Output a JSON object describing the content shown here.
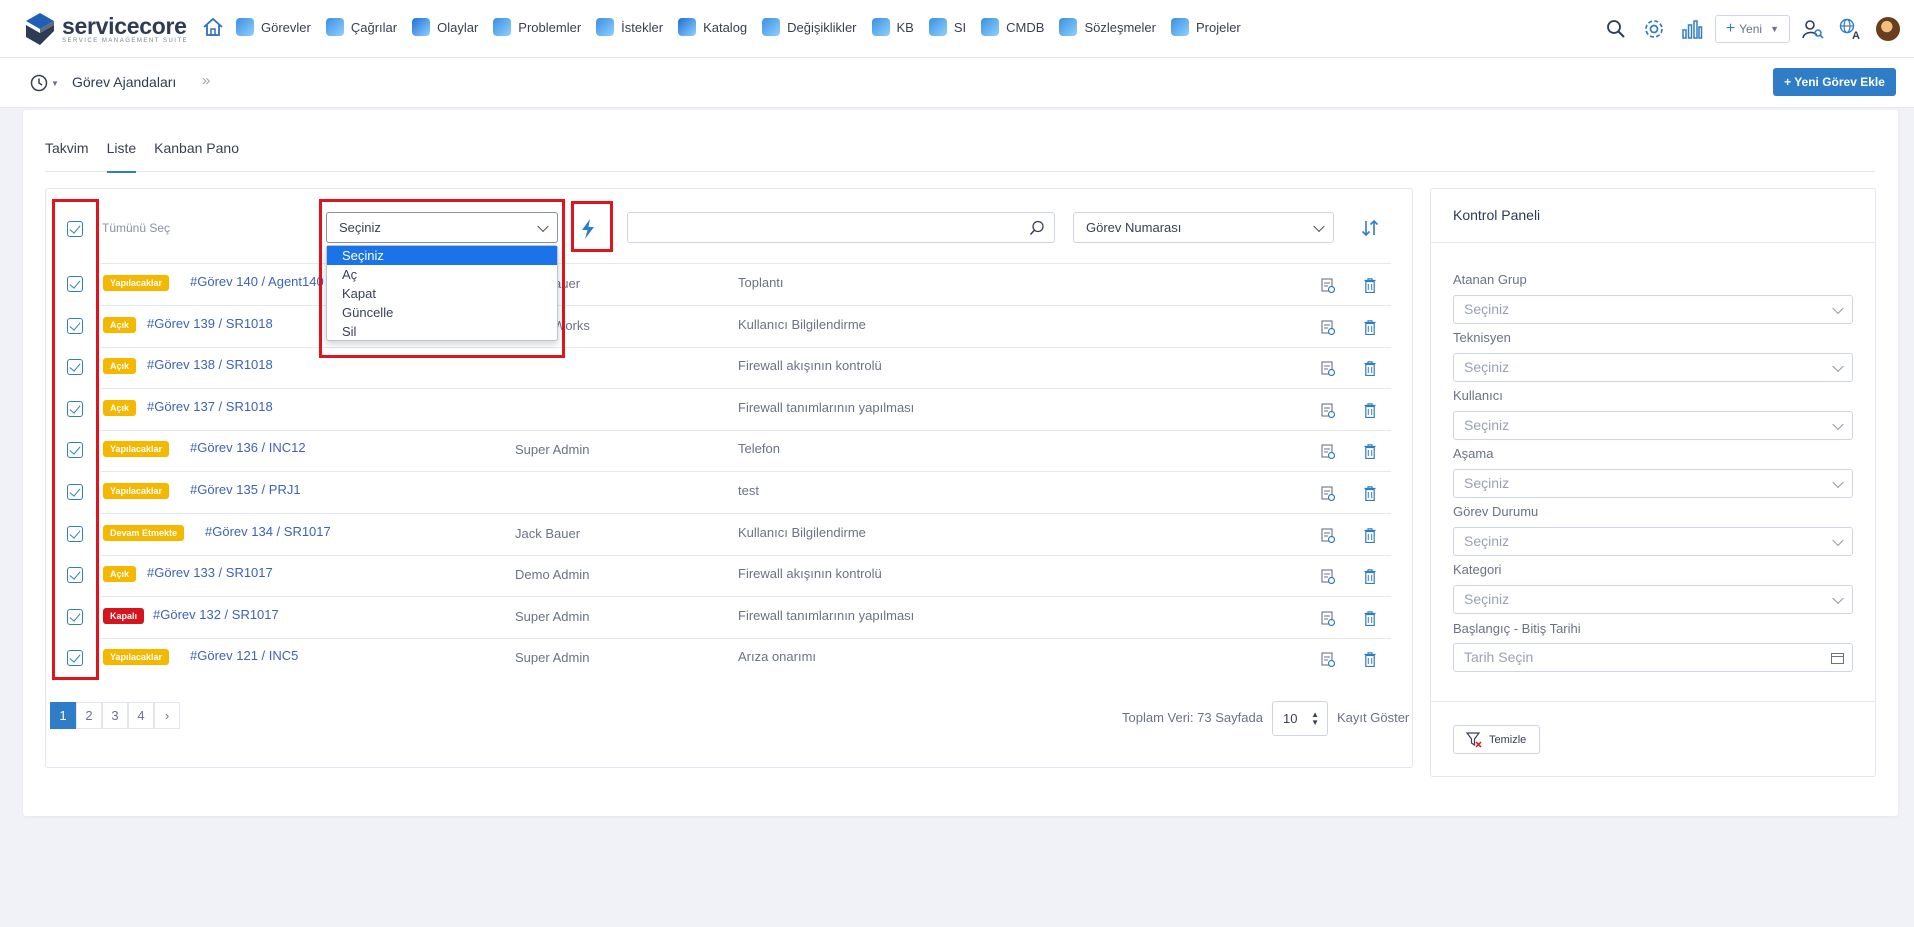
{
  "app": {
    "name": "servicecore",
    "tagline": "SERVICE MANAGEMENT SUITE"
  },
  "nav": [
    {
      "label": "Görevler",
      "icon": "tasks-icon",
      "color": "#3b8fe0"
    },
    {
      "label": "Çağrılar",
      "icon": "calls-icon",
      "color": "#3b8fe0"
    },
    {
      "label": "Olaylar",
      "icon": "incidents-icon",
      "color": "#1d6fd6"
    },
    {
      "label": "Problemler",
      "icon": "problems-icon",
      "color": "#3b8fe0"
    },
    {
      "label": "İstekler",
      "icon": "requests-icon",
      "color": "#3b8fe0"
    },
    {
      "label": "Katalog",
      "icon": "catalog-icon",
      "color": "#1d6fd6"
    },
    {
      "label": "Değişiklikler",
      "icon": "changes-icon",
      "color": "#3b8fe0"
    },
    {
      "label": "KB",
      "icon": "kb-icon",
      "color": "#3b8fe0"
    },
    {
      "label": "SI",
      "icon": "si-icon",
      "color": "#3b8fe0"
    },
    {
      "label": "CMDB",
      "icon": "cmdb-icon",
      "color": "#3b8fe0"
    },
    {
      "label": "Sözleşmeler",
      "icon": "contracts-icon",
      "color": "#3b8fe0"
    },
    {
      "label": "Projeler",
      "icon": "projects-icon",
      "color": "#3b8fe0"
    }
  ],
  "topright": {
    "new_label": "Yeni"
  },
  "breadcrumb": {
    "title": "Görev Ajandaları"
  },
  "add_task_button": "+ Yeni Görev Ekle",
  "tabs": [
    {
      "label": "Takvim",
      "active": false
    },
    {
      "label": "Liste",
      "active": true
    },
    {
      "label": "Kanban Pano",
      "active": false
    }
  ],
  "toolbar": {
    "select_all_label": "Tümünü Seç",
    "action_select_value": "Seçiniz",
    "action_options": [
      "Seçiniz",
      "Aç",
      "Kapat",
      "Güncelle",
      "Sil"
    ],
    "search_value": "",
    "sort_select_value": "Görev Numarası"
  },
  "rows": [
    {
      "status": "Yapılacaklar",
      "status_color": "#f5b800",
      "task": "#Görev 140 / Agent140",
      "user": "Jack Bauer",
      "title": "Toplantı"
    },
    {
      "status": "Açık",
      "status_color": "#f5b800",
      "task": "#Görev 139 / SR1018",
      "user": "Demo Works",
      "title": "Kullanıcı Bilgilendirme"
    },
    {
      "status": "Açık",
      "status_color": "#f5b800",
      "task": "#Görev 138 / SR1018",
      "user": "",
      "title": "Firewall akışının kontrolü"
    },
    {
      "status": "Açık",
      "status_color": "#f5b800",
      "task": "#Görev 137 / SR1018",
      "user": "",
      "title": "Firewall tanımlarının yapılması"
    },
    {
      "status": "Yapılacaklar",
      "status_color": "#f5b800",
      "task": "#Görev 136 / INC12",
      "user": "Super Admin",
      "title": "Telefon"
    },
    {
      "status": "Yapılacaklar",
      "status_color": "#f5b800",
      "task": "#Görev 135 / PRJ1",
      "user": "",
      "title": "test"
    },
    {
      "status": "Devam Etmekte",
      "status_color": "#f5b800",
      "task": "#Görev 134 / SR1017",
      "user": "Jack Bauer",
      "title": "Kullanıcı Bilgilendirme"
    },
    {
      "status": "Açık",
      "status_color": "#f5b800",
      "task": "#Görev 133 / SR1017",
      "user": "Demo Admin",
      "title": "Firewall akışının kontrolü"
    },
    {
      "status": "Kapalı",
      "status_color": "#d6141e",
      "task": "#Görev 132 / SR1017",
      "user": "Super Admin",
      "title": "Firewall tanımlarının yapılması"
    },
    {
      "status": "Yapılacaklar",
      "status_color": "#f5b800",
      "task": "#Görev 121 / INC5",
      "user": "Super Admin",
      "title": "Arıza onarımı"
    }
  ],
  "pagination": {
    "pages": [
      "1",
      "2",
      "3",
      "4",
      "›"
    ],
    "current": "1",
    "total_label": "Toplam Veri: 73",
    "per_page_prefix": "Sayfada",
    "per_page_value": "10",
    "per_page_suffix": "Kayıt Göster"
  },
  "control_panel": {
    "title": "Kontrol Paneli",
    "filters": [
      {
        "label": "Atanan Grup",
        "placeholder": "Seçiniz"
      },
      {
        "label": "Teknisyen",
        "placeholder": "Seçiniz"
      },
      {
        "label": "Kullanıcı",
        "placeholder": "Seçiniz"
      },
      {
        "label": "Aşama",
        "placeholder": "Seçiniz"
      },
      {
        "label": "Görev Durumu",
        "placeholder": "Seçiniz"
      },
      {
        "label": "Kategori",
        "placeholder": "Seçiniz"
      }
    ],
    "date_label": "Başlangıç - Bitiş Tarihi",
    "date_placeholder": "Tarih Seçin",
    "clear_button": "Temizle"
  }
}
